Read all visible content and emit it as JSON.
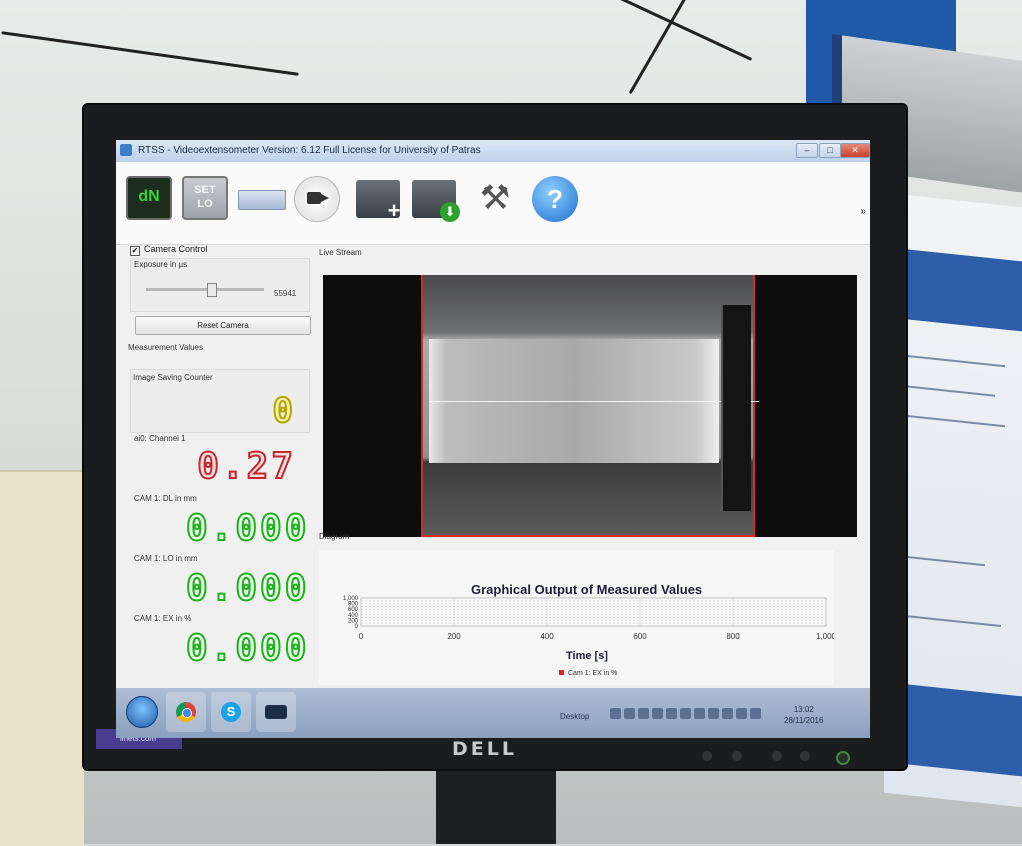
{
  "window": {
    "title": "RTSS - Videoextensometer Version: 6.12 Full License for University of Patras",
    "minimize": "–",
    "maximize": "□",
    "close": "✕"
  },
  "toolbar": {
    "dn_label": "dN",
    "set_label": "SET",
    "lo_label": "LO",
    "more": "»",
    "help_glyph": "?",
    "tools_glyph": "⚒",
    "plus_glyph": "+",
    "download_glyph": "⬇"
  },
  "camera": {
    "control_label": "Camera Control",
    "control_checked": "✔",
    "exposure_label": "Exposure in µs",
    "exposure_value": "55941",
    "exposure_level": 0.55,
    "reset_button": "Reset Camera"
  },
  "measurement": {
    "header": "Measurement Values",
    "image_counter_label": "Image Saving Counter",
    "image_counter_value": "0",
    "channel_label": "ai0: Channel 1",
    "channel_value": "0.27",
    "dl_label": "CAM 1: DL in mm",
    "dl_value": "0.000",
    "lo_label": "CAM 1: LO in mm",
    "lo_value": "0.000",
    "ex_label": "CAM 1: EX in %",
    "ex_value": "0.000"
  },
  "stream": {
    "label": "Live Stream"
  },
  "diagram": {
    "label": "Diagram"
  },
  "chart_data": {
    "type": "line",
    "title": "Graphical Output of Measured Values",
    "xlabel": "Time [s]",
    "ylabel": "",
    "xlim": [
      0,
      1000
    ],
    "ylim": [
      0,
      1000
    ],
    "x_ticks": [
      "0",
      "200",
      "400",
      "600",
      "800",
      "1,000"
    ],
    "y_ticks": [
      "1,000",
      "800",
      "600",
      "400",
      "200",
      "0"
    ],
    "series": [
      {
        "name": "Cam 1: EX in %",
        "color": "#e22222",
        "x": [],
        "y": []
      }
    ],
    "grid": true,
    "legend": "bottom-center"
  },
  "taskbar": {
    "desktop_label": "Desktop",
    "clock_time": "13:02",
    "clock_date": "28/11/2016"
  },
  "monitor": {
    "brand": "DELL",
    "sticker_text": "linets.com"
  }
}
